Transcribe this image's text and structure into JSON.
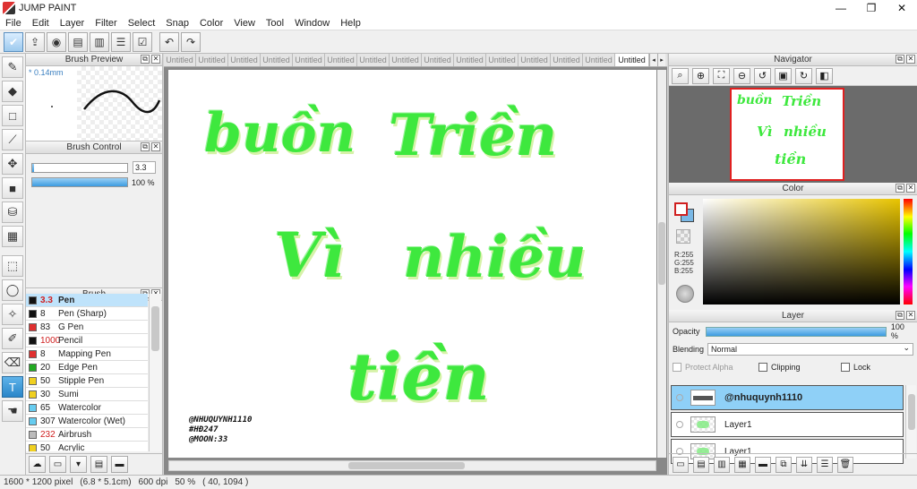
{
  "window": {
    "title": "JUMP PAINT",
    "minimize": "—",
    "maximize": "❐",
    "close": "✕"
  },
  "menu": [
    "File",
    "Edit",
    "Layer",
    "Filter",
    "Select",
    "Snap",
    "Color",
    "View",
    "Tool",
    "Window",
    "Help"
  ],
  "panels": {
    "brush_preview": {
      "title": "Brush Preview",
      "size": "* 0.14mm"
    },
    "brush_control": {
      "title": "Brush Control",
      "size_value": "3.3",
      "opacity_value": "100 %",
      "size_fraction": 0.02,
      "opacity_fraction": 1.0
    },
    "brush": {
      "title": "Brush"
    },
    "navigator": {
      "title": "Navigator"
    },
    "color": {
      "title": "Color",
      "r": "R:255",
      "g": "G:255",
      "b": "B:255"
    },
    "layer": {
      "title": "Layer",
      "opacity_label": "Opacity",
      "opacity_value": "100 %",
      "opacity_fraction": 1.0,
      "blending_label": "Blending",
      "blending_value": "Normal",
      "protect_alpha": "Protect Alpha",
      "clipping": "Clipping",
      "lock": "Lock"
    }
  },
  "brushes": [
    {
      "size": "3.3",
      "name": "Pen",
      "color": "#111111",
      "selected": true,
      "red": true
    },
    {
      "size": "8",
      "name": "Pen (Sharp)",
      "color": "#111111"
    },
    {
      "size": "83",
      "name": "G Pen",
      "color": "#e03030"
    },
    {
      "size": "1000",
      "name": "Pencil",
      "color": "#111111",
      "red": true
    },
    {
      "size": "8",
      "name": "Mapping Pen",
      "color": "#e03030"
    },
    {
      "size": "20",
      "name": "Edge Pen",
      "color": "#22aa22"
    },
    {
      "size": "50",
      "name": "Stipple Pen",
      "color": "#f0d020"
    },
    {
      "size": "30",
      "name": "Sumi",
      "color": "#f0d020"
    },
    {
      "size": "65",
      "name": "Watercolor",
      "color": "#66ccf0"
    },
    {
      "size": "307",
      "name": "Watercolor (Wet)",
      "color": "#66ccf0"
    },
    {
      "size": "232",
      "name": "Airbrush",
      "color": "#bbbbbb",
      "red": true
    },
    {
      "size": "50",
      "name": "Acrylic",
      "color": "#f0d020"
    }
  ],
  "tabs": [
    "Untitled",
    "Untitled",
    "Untitled",
    "Untitled",
    "Untitled",
    "Untitled",
    "Untitled",
    "Untitled",
    "Untitled",
    "Untitled",
    "Untitled",
    "Untitled",
    "Untitled",
    "Untitled",
    "Untitled"
  ],
  "canvas": {
    "line1a": "buồn",
    "line1b": "Triền",
    "line2a": "Vì",
    "line2b": "nhiều",
    "line3": "tiền",
    "signature": [
      "@NHUQUYNH1110",
      "#HĐ247",
      "@MOON:33"
    ]
  },
  "layers": [
    {
      "name": "@nhuquynh1110",
      "selected": true,
      "kind": "text"
    },
    {
      "name": "Layer1",
      "kind": "raster"
    },
    {
      "name": "Layer1",
      "kind": "raster"
    }
  ],
  "status": {
    "pixels": "1600 * 1200 pixel",
    "size": "(6.8 * 5.1cm)",
    "dpi": "600 dpi",
    "zoom": "50 %",
    "cursor": "( 40, 1094 )"
  },
  "colors": {
    "accent": "#3c9be0",
    "lettering": "#3ee83e",
    "nav_frame": "#e02020"
  }
}
